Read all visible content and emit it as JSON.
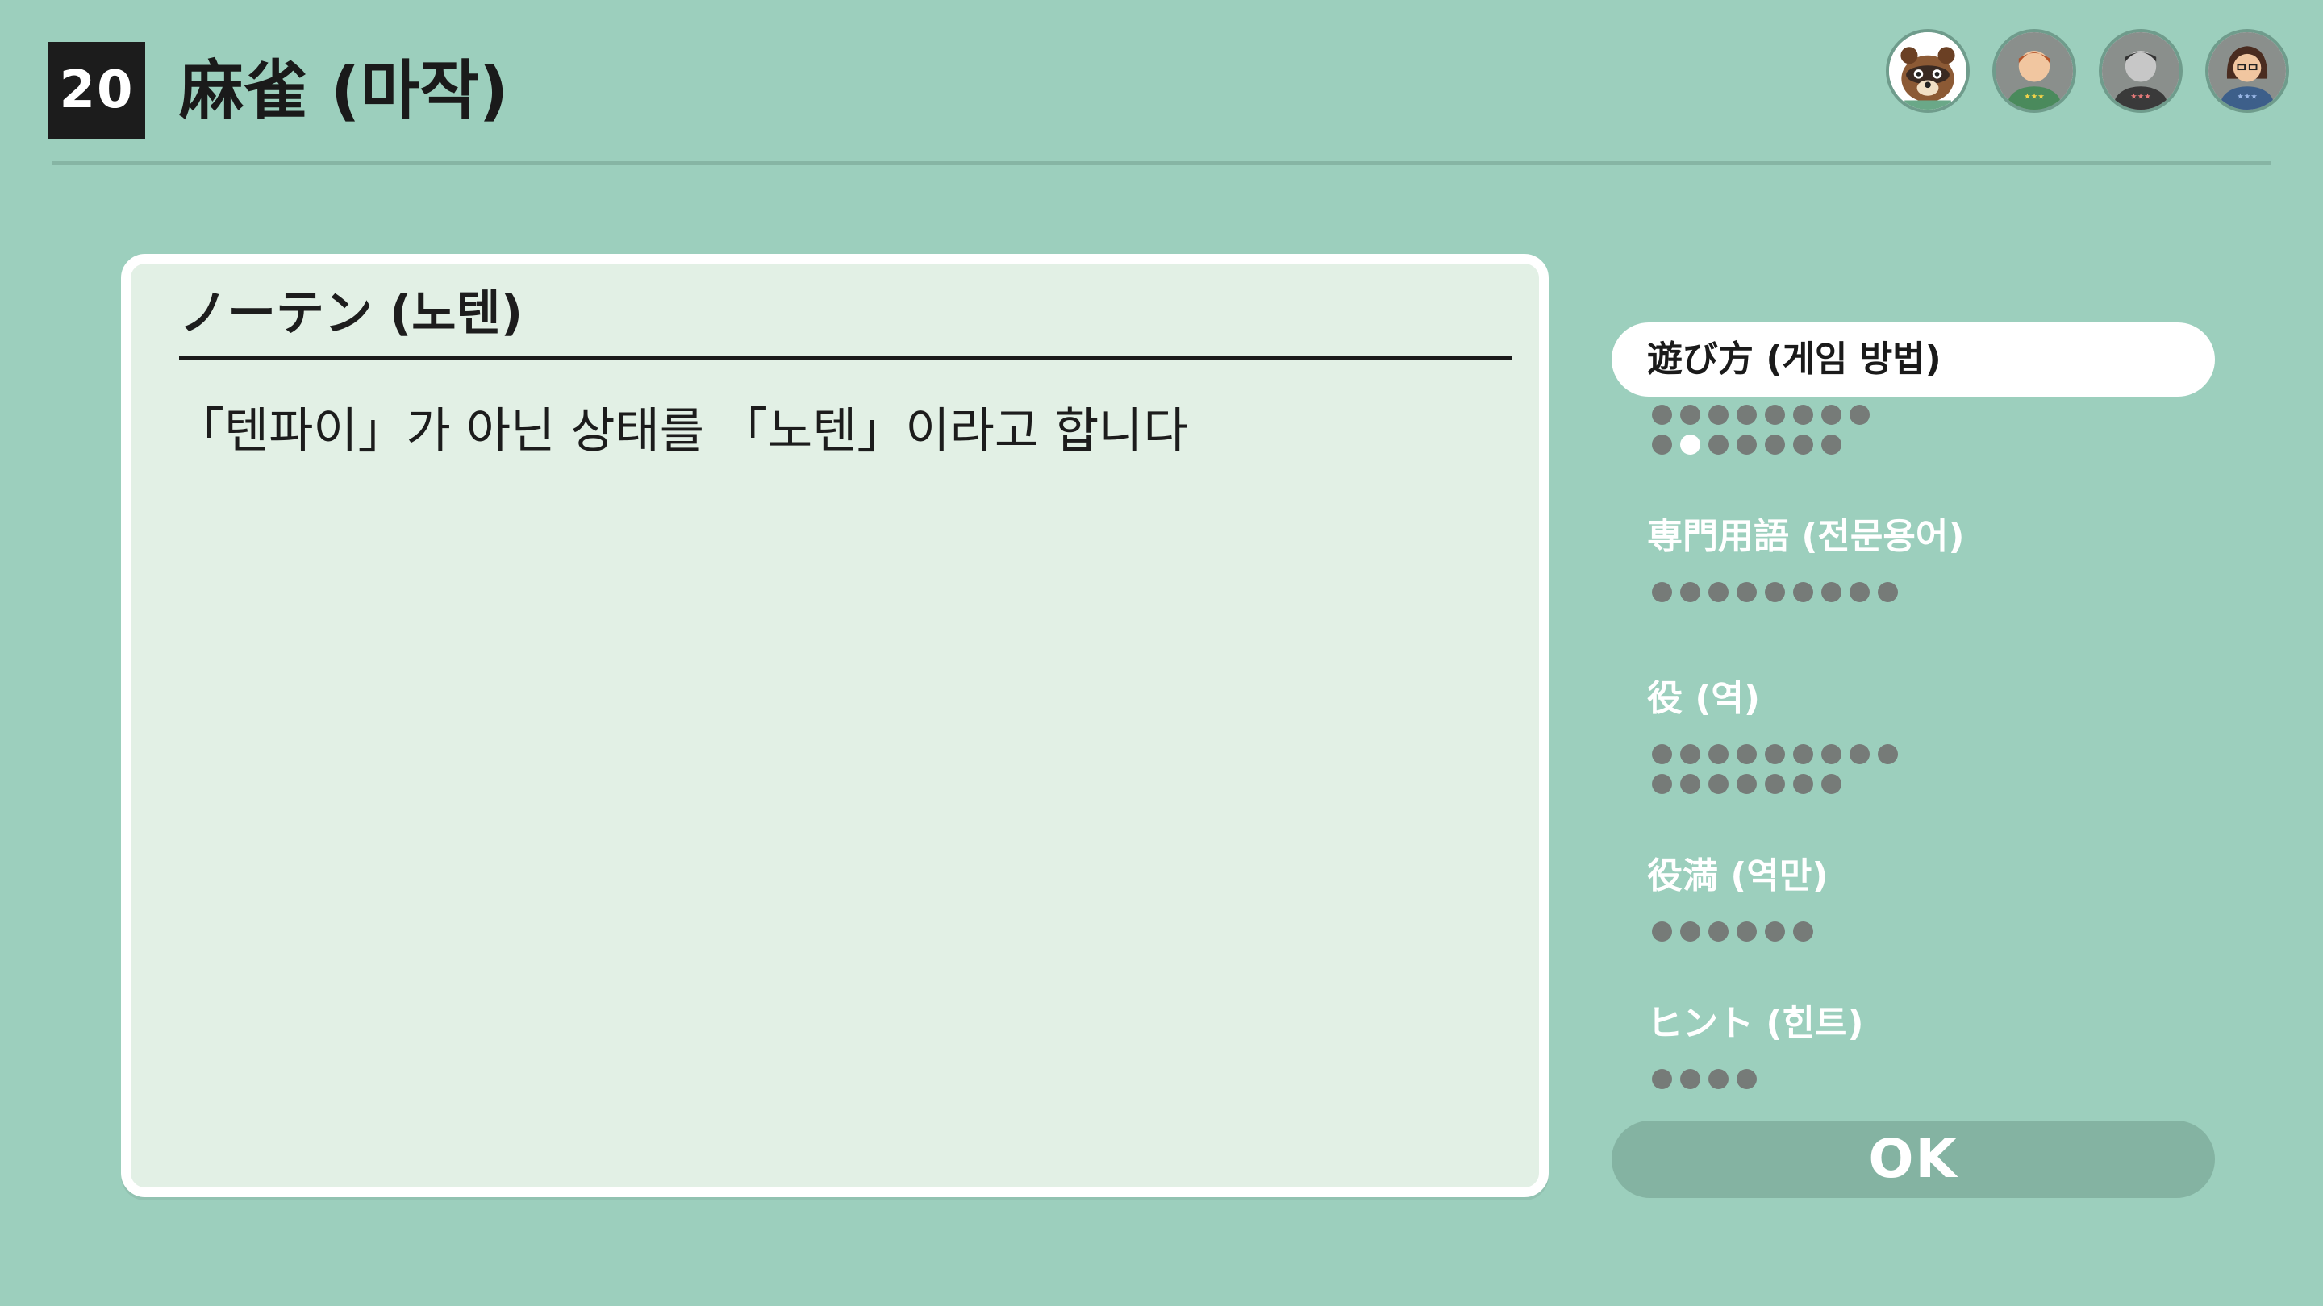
{
  "header": {
    "game_number": "20",
    "title": "麻雀 (마작)"
  },
  "players": [
    {
      "name": "tom-nook-avatar"
    },
    {
      "name": "player-avatar-2"
    },
    {
      "name": "player-avatar-3"
    },
    {
      "name": "player-avatar-4"
    }
  ],
  "panel": {
    "title": "ノーテン (노텐)",
    "body": "「텐파이」가 아닌 상태를 「노텐」이라고 합니다"
  },
  "sidebar": {
    "sections": [
      {
        "label": "遊び方 (게임 방법)",
        "active": true,
        "dot_rows": [
          8,
          7
        ],
        "current_dot": {
          "row": 1,
          "index": 1
        }
      },
      {
        "label": "専門用語 (전문용어)",
        "active": false,
        "dot_rows": [
          9
        ],
        "current_dot": null
      },
      {
        "label": "役 (역)",
        "active": false,
        "dot_rows": [
          9,
          7
        ],
        "current_dot": null
      },
      {
        "label": "役満 (역만)",
        "active": false,
        "dot_rows": [
          6
        ],
        "current_dot": null
      },
      {
        "label": "ヒント (힌트)",
        "active": false,
        "dot_rows": [
          4
        ],
        "current_dot": null
      }
    ]
  },
  "ok_button": {
    "label": "OK"
  },
  "colors": {
    "background": "#9ccfbd",
    "panel": "#e2f0e5",
    "dot": "#767b78",
    "ok_button": "#84b3a2"
  }
}
